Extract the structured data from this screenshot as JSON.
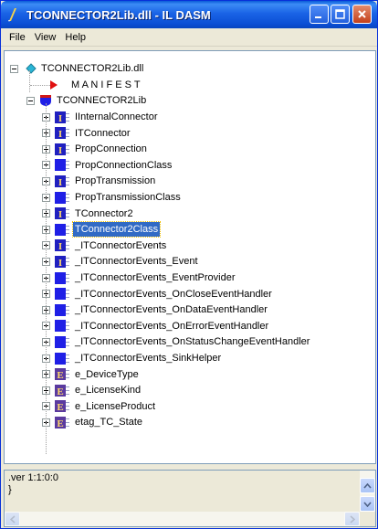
{
  "window": {
    "title": "TCONNECTOR2Lib.dll - IL DASM"
  },
  "menu": {
    "items": [
      "File",
      "View",
      "Help"
    ]
  },
  "tree": {
    "root_label": "TCONNECTOR2Lib.dll",
    "manifest_label": "M A N I F E S T",
    "namespace_label": "TCONNECTOR2Lib",
    "children": [
      {
        "label": "IInternalConnector",
        "icon": "interface-icon"
      },
      {
        "label": "ITConnector",
        "icon": "interface-icon"
      },
      {
        "label": "PropConnection",
        "icon": "interface-icon"
      },
      {
        "label": "PropConnectionClass",
        "icon": "class-icon"
      },
      {
        "label": "PropTransmission",
        "icon": "interface-icon"
      },
      {
        "label": "PropTransmissionClass",
        "icon": "class-icon"
      },
      {
        "label": "TConnector2",
        "icon": "interface-icon"
      },
      {
        "label": "TConnector2Class",
        "icon": "class-icon",
        "selected": true
      },
      {
        "label": "_ITConnectorEvents",
        "icon": "interface-icon"
      },
      {
        "label": "_ITConnectorEvents_Event",
        "icon": "interface-icon"
      },
      {
        "label": "_ITConnectorEvents_EventProvider",
        "icon": "class-icon"
      },
      {
        "label": "_ITConnectorEvents_OnCloseEventHandler",
        "icon": "class-icon"
      },
      {
        "label": "_ITConnectorEvents_OnDataEventHandler",
        "icon": "class-icon"
      },
      {
        "label": "_ITConnectorEvents_OnErrorEventHandler",
        "icon": "class-icon"
      },
      {
        "label": "_ITConnectorEvents_OnStatusChangeEventHandler",
        "icon": "class-icon"
      },
      {
        "label": "_ITConnectorEvents_SinkHelper",
        "icon": "class-icon"
      },
      {
        "label": "e_DeviceType",
        "icon": "enum-icon"
      },
      {
        "label": "e_LicenseKind",
        "icon": "enum-icon"
      },
      {
        "label": "e_LicenseProduct",
        "icon": "enum-icon"
      },
      {
        "label": "etag_TC_State",
        "icon": "enum-icon"
      }
    ]
  },
  "info": {
    "line1": ".ver 1:1:0:0",
    "line2": "}"
  },
  "colors": {
    "class_blue": "#1f1fe6",
    "interface_blue": "#2020c0",
    "manifest_red": "#e01010",
    "selection": "#316ac5"
  }
}
